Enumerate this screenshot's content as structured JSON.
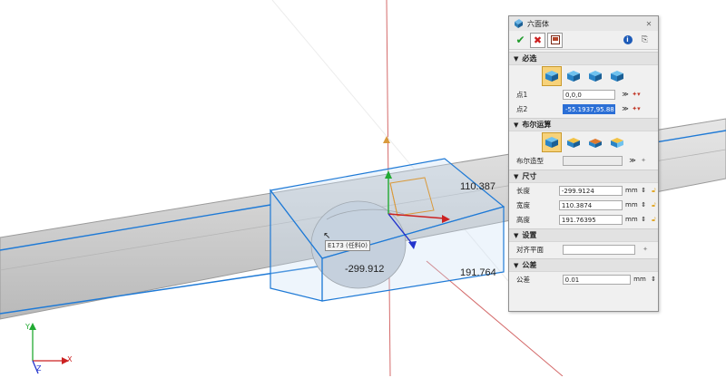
{
  "viewport": {
    "dimensions": {
      "width": "-299.912",
      "height": "110.387",
      "depth": "191.764"
    },
    "tooltip": "E173 (任料0)",
    "triad_labels": {
      "x": "X",
      "y": "Y",
      "z": "Z"
    }
  },
  "panel": {
    "title": "六面体",
    "colors": {
      "accent": "#2b6fd6",
      "selected": "#f7d27a",
      "edge": "#1f7ad6"
    },
    "sections": {
      "required": {
        "label": "必选",
        "point1_label": "点1",
        "point1_value": "0,0,0",
        "point2_label": "点2",
        "point2_value": "-55.1937,95.8819"
      },
      "boolean": {
        "label": "布尔运算",
        "shape_label": "布尔造型",
        "shape_value": ""
      },
      "size": {
        "label": "尺寸",
        "length_label": "长度",
        "length_value": "-299.9124",
        "length_unit": "mm",
        "width_label": "宽度",
        "width_value": "110.3874",
        "width_unit": "mm",
        "height_label": "高度",
        "height_value": "191.76395",
        "height_unit": "mm"
      },
      "settings": {
        "label": "设置",
        "align_label": "对齐平面",
        "align_value": ""
      },
      "tolerance": {
        "label": "公差",
        "tol_label": "公差",
        "tol_value": "0.01",
        "tol_unit": "mm"
      }
    }
  }
}
